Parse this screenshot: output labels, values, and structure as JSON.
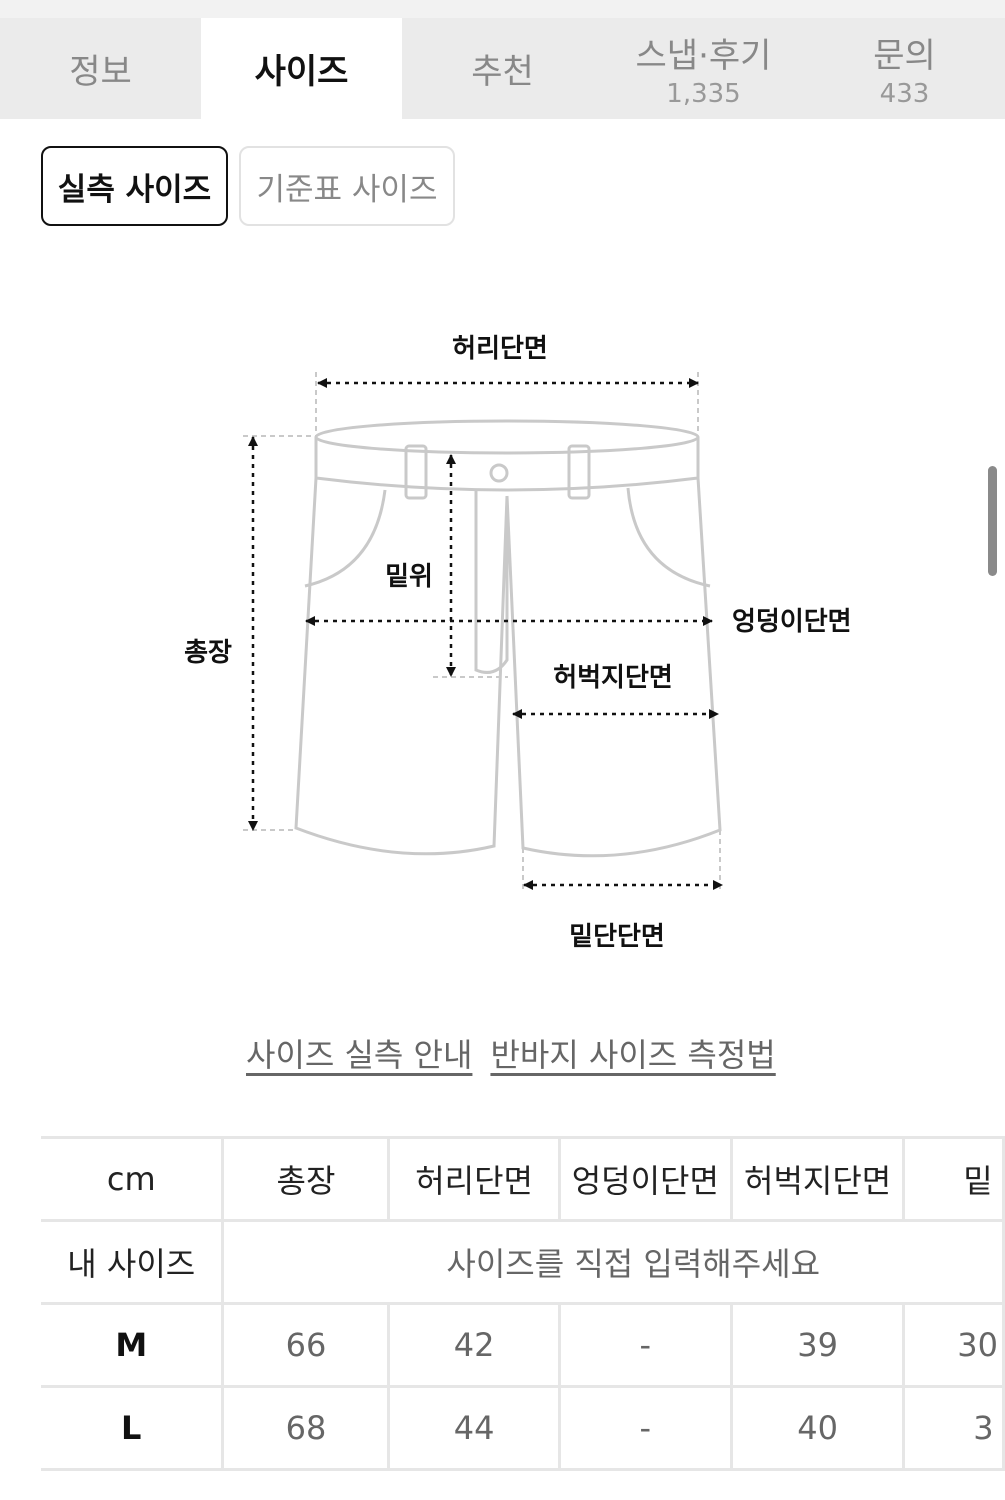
{
  "tabs": [
    {
      "label": "정보",
      "count": ""
    },
    {
      "label": "사이즈",
      "count": ""
    },
    {
      "label": "추천",
      "count": ""
    },
    {
      "label": "스냅·후기",
      "count": "1,335"
    },
    {
      "label": "문의",
      "count": "433"
    }
  ],
  "active_tab": 1,
  "size_toggle": {
    "actual": "실측 사이즈",
    "standard": "기준표 사이즈"
  },
  "diagram": {
    "waist": "허리단면",
    "rise": "밑위",
    "hip": "엉덩이단면",
    "length": "총장",
    "thigh": "허벅지단면",
    "hem": "밑단단면"
  },
  "links": {
    "guide": "사이즈 실측 안내",
    "how_to": "반바지 사이즈 측정법"
  },
  "table": {
    "headers": [
      "cm",
      "총장",
      "허리단면",
      "엉덩이단면",
      "허벅지단면",
      "밑"
    ],
    "my_size_label": "내 사이즈",
    "my_size_prompt": "사이즈를 직접 입력해주세요",
    "rows": [
      {
        "size": "M",
        "values": [
          "66",
          "42",
          "-",
          "39",
          "30"
        ]
      },
      {
        "size": "L",
        "values": [
          "68",
          "44",
          "-",
          "40",
          "3"
        ]
      }
    ]
  },
  "colors": {
    "accent": "#111111",
    "muted": "#888888",
    "tab_bg": "#ebebeb",
    "border": "#e6e6e6"
  }
}
